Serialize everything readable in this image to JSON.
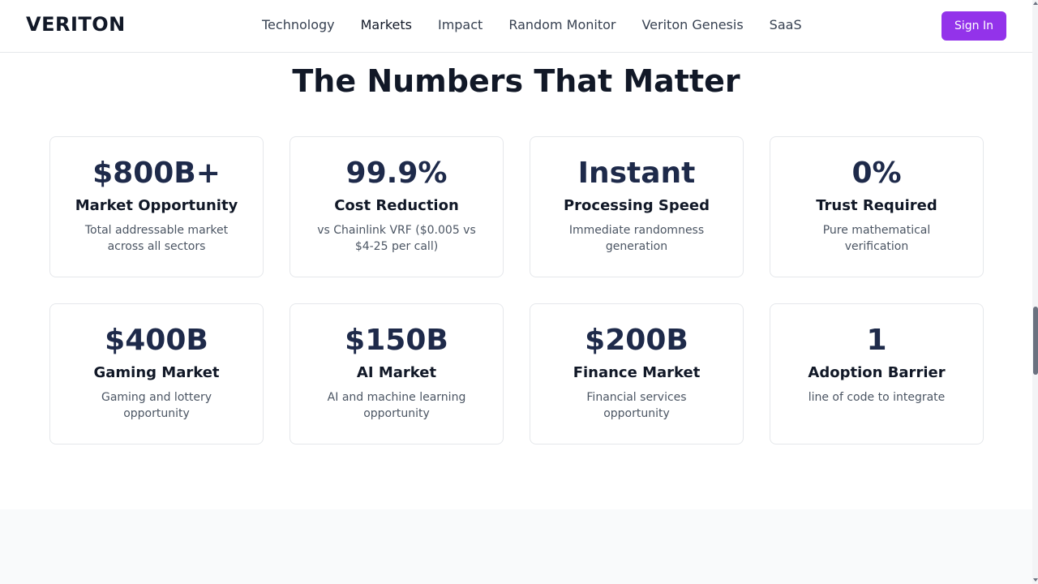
{
  "nav": {
    "logo": "VERITON",
    "links": [
      "Technology",
      "Markets",
      "Impact",
      "Random Monitor",
      "Veriton Genesis",
      "SaaS"
    ],
    "sign_in_label": "Sign In"
  },
  "section": {
    "title": "The Numbers That Matter"
  },
  "stats": [
    {
      "value": "$800B+",
      "label": "Market Opportunity",
      "desc": "Total addressable market across all sectors"
    },
    {
      "value": "99.9%",
      "label": "Cost Reduction",
      "desc": "vs Chainlink VRF ($0.005 vs $4-25 per call)"
    },
    {
      "value": "Instant",
      "label": "Processing Speed",
      "desc": "Immediate randomness generation"
    },
    {
      "value": "0%",
      "label": "Trust Required",
      "desc": "Pure mathematical verification"
    },
    {
      "value": "$400B",
      "label": "Gaming Market",
      "desc": "Gaming and lottery opportunity"
    },
    {
      "value": "$150B",
      "label": "AI Market",
      "desc": "AI and machine learning opportunity"
    },
    {
      "value": "$200B",
      "label": "Finance Market",
      "desc": "Financial services opportunity"
    },
    {
      "value": "1",
      "label": "Adoption Barrier",
      "desc": "line of code to integrate"
    }
  ],
  "colors": {
    "accent": "#9333ea",
    "stat_value": "#1e2a4a",
    "border": "#e5e7eb"
  }
}
